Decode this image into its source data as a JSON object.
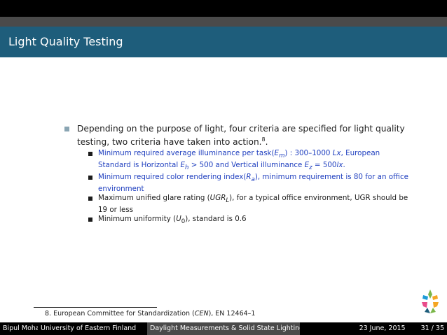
{
  "slide": {
    "title": "Light Quality Testing",
    "main_text": "Depending on the purpose of light, four criteria are specified for light quality testing, two criteria have taken into action.",
    "footnote_marker": "8",
    "main_text_end": ".",
    "criteria": [
      {
        "parts": [
          "Minimum required average illuminance per task(",
          "E",
          "m",
          ") : 300–1000 ",
          "Lx",
          ", European Standard is Horizontal ",
          "E",
          "h",
          " > 500 and Vertical illuminance ",
          "E",
          "z",
          " = 500",
          "lx",
          "."
        ]
      },
      {
        "parts": [
          "Minimum required color rendering index(",
          "R",
          "a",
          "), minimum requirement is 80 for an office environment"
        ]
      },
      {
        "parts": [
          "Maximum unified glare rating (",
          "UGR",
          "L",
          "), for a typical office environment, UGR should be 19 or less"
        ]
      },
      {
        "parts": [
          "Minimum uniformity (",
          "U",
          "0",
          "), standard is 0.6"
        ]
      }
    ]
  },
  "footnote": {
    "number": "8.",
    "text_before": "European Committee for Standardization (",
    "abbr": "CEN",
    "text_after": "), EN 12464–1"
  },
  "footer": {
    "author": "Bipul Mohanto",
    "institution": "University of Eastern Finland",
    "talk_title": "Daylight Measurements & Solid State Lighting Panel De",
    "date": "23 June, 2015",
    "page": "31 / 35"
  },
  "colors": {
    "title_bar": "#1e5d7b",
    "highlight_text": "#1f3fbf"
  },
  "icons": {
    "logo": "university-logo-icon"
  }
}
